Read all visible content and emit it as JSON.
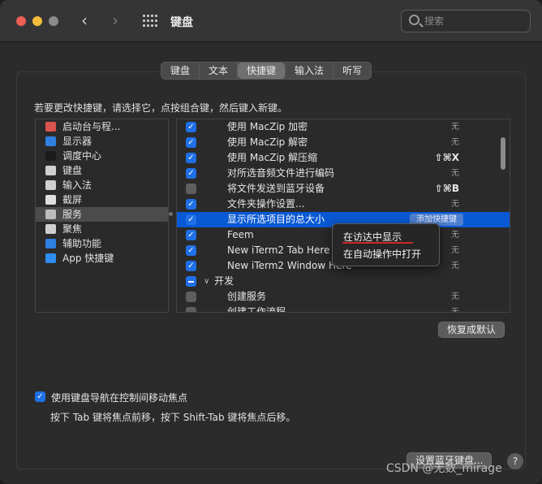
{
  "window": {
    "title": "键盘"
  },
  "search": {
    "placeholder": "搜索"
  },
  "tabs": [
    "键盘",
    "文本",
    "快捷键",
    "输入法",
    "听写"
  ],
  "instruction": "若要更改快捷键，请选择它，点按组合键，然后键入新键。",
  "categories": [
    {
      "label": "启动台与程...",
      "icon": "launchpad-icon",
      "color": "#d9534f",
      "selected": false
    },
    {
      "label": "显示器",
      "icon": "display-icon",
      "color": "#2f7fe0",
      "selected": false
    },
    {
      "label": "调度中心",
      "icon": "mission-control-icon",
      "color": "#1b1b1b",
      "selected": false
    },
    {
      "label": "键盘",
      "icon": "keyboard-icon",
      "color": "#cfcfcf",
      "selected": false
    },
    {
      "label": "输入法",
      "icon": "input-source-icon",
      "color": "#cfcfcf",
      "selected": false
    },
    {
      "label": "截屏",
      "icon": "screenshot-icon",
      "color": "#e0e0e0",
      "selected": false
    },
    {
      "label": "服务",
      "icon": "services-gear-icon",
      "color": "#bdbdbd",
      "selected": true
    },
    {
      "label": "聚焦",
      "icon": "spotlight-icon",
      "color": "#d0d0d0",
      "selected": false
    },
    {
      "label": "辅助功能",
      "icon": "accessibility-icon",
      "color": "#2f7fe0",
      "selected": false
    },
    {
      "label": "App 快捷键",
      "icon": "app-store-icon",
      "color": "#2f8cf0",
      "selected": false
    }
  ],
  "shortcuts": [
    {
      "checked": true,
      "label": "使用 MacZip 加密",
      "key": "无",
      "strong": false
    },
    {
      "checked": true,
      "label": "使用 MacZip 解密",
      "key": "无",
      "strong": false
    },
    {
      "checked": true,
      "label": "使用 MacZip 解压缩",
      "key": "⇧⌘X",
      "strong": true
    },
    {
      "checked": true,
      "label": "对所选音频文件进行编码",
      "key": "无",
      "strong": false
    },
    {
      "checked": false,
      "label": "将文件发送到蓝牙设备",
      "key": "⇧⌘B",
      "strong": true
    },
    {
      "checked": true,
      "label": "文件夹操作设置...",
      "key": "无",
      "strong": false
    },
    {
      "checked": true,
      "label": "显示所选项目的总大小",
      "key": "",
      "strong": false,
      "selected": true,
      "button": "添加快捷键"
    },
    {
      "checked": true,
      "label": "Feem",
      "key": "无",
      "strong": false
    },
    {
      "checked": true,
      "label": "New iTerm2 Tab Here",
      "key": "无",
      "strong": false
    },
    {
      "checked": true,
      "label": "New iTerm2 Window Here",
      "key": "无",
      "strong": false
    },
    {
      "group": true,
      "label": "开发"
    },
    {
      "checked": false,
      "label": "创建服务",
      "key": "无",
      "strong": false
    },
    {
      "checked": false,
      "label": "创建工作流程",
      "key": "无",
      "strong": false
    }
  ],
  "context_menu": [
    "在访达中显示",
    "在自动操作中打开"
  ],
  "buttons": {
    "restore": "恢复成默认",
    "bluetooth": "设置蓝牙键盘...",
    "help": "?"
  },
  "keyboard_nav": {
    "label": "使用键盘导航在控制间移动焦点",
    "note": "按下 Tab 键将焦点前移，按下 Shift-Tab 键将焦点后移。"
  },
  "watermark": "CSDN @无数_mirage"
}
